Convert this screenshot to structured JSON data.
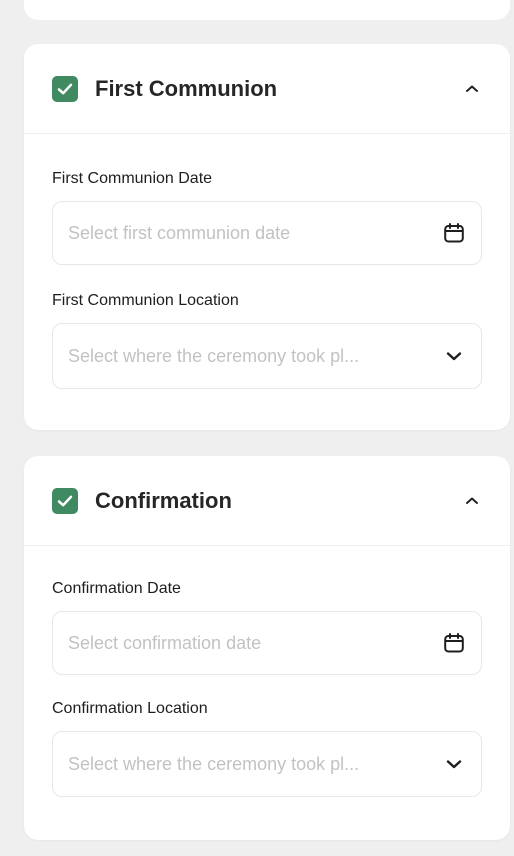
{
  "sections": [
    {
      "title": "First Communion",
      "checked": true,
      "date_label": "First Communion Date",
      "date_placeholder": "Select first communion date",
      "location_label": "First Communion Location",
      "location_placeholder": "Select where the ceremony took pl..."
    },
    {
      "title": "Confirmation",
      "checked": true,
      "date_label": "Confirmation Date",
      "date_placeholder": "Select confirmation date",
      "location_label": "Confirmation Location",
      "location_placeholder": "Select where the ceremony took pl..."
    }
  ],
  "colors": {
    "checkbox": "#3f8a60",
    "background": "#efefef",
    "placeholder": "#c2c2c2"
  },
  "icons": {
    "checkbox": "checkmark-icon",
    "collapse": "chevron-up-icon",
    "date": "calendar-icon",
    "location": "chevron-down-icon"
  }
}
